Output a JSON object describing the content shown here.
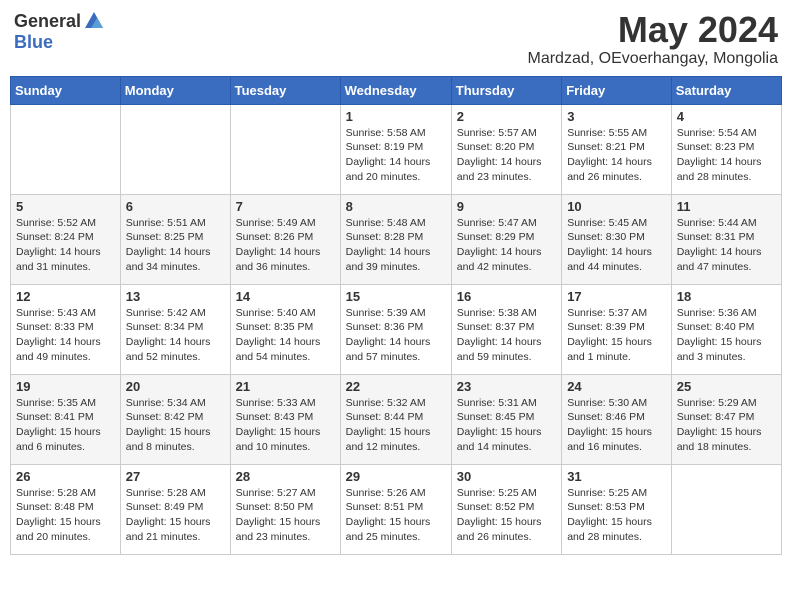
{
  "logo": {
    "general": "General",
    "blue": "Blue"
  },
  "title": "May 2024",
  "subtitle": "Mardzad, OEvoerhangay, Mongolia",
  "days_of_week": [
    "Sunday",
    "Monday",
    "Tuesday",
    "Wednesday",
    "Thursday",
    "Friday",
    "Saturday"
  ],
  "weeks": [
    [
      {
        "day": "",
        "info": ""
      },
      {
        "day": "",
        "info": ""
      },
      {
        "day": "",
        "info": ""
      },
      {
        "day": "1",
        "info": "Sunrise: 5:58 AM\nSunset: 8:19 PM\nDaylight: 14 hours\nand 20 minutes."
      },
      {
        "day": "2",
        "info": "Sunrise: 5:57 AM\nSunset: 8:20 PM\nDaylight: 14 hours\nand 23 minutes."
      },
      {
        "day": "3",
        "info": "Sunrise: 5:55 AM\nSunset: 8:21 PM\nDaylight: 14 hours\nand 26 minutes."
      },
      {
        "day": "4",
        "info": "Sunrise: 5:54 AM\nSunset: 8:23 PM\nDaylight: 14 hours\nand 28 minutes."
      }
    ],
    [
      {
        "day": "5",
        "info": "Sunrise: 5:52 AM\nSunset: 8:24 PM\nDaylight: 14 hours\nand 31 minutes."
      },
      {
        "day": "6",
        "info": "Sunrise: 5:51 AM\nSunset: 8:25 PM\nDaylight: 14 hours\nand 34 minutes."
      },
      {
        "day": "7",
        "info": "Sunrise: 5:49 AM\nSunset: 8:26 PM\nDaylight: 14 hours\nand 36 minutes."
      },
      {
        "day": "8",
        "info": "Sunrise: 5:48 AM\nSunset: 8:28 PM\nDaylight: 14 hours\nand 39 minutes."
      },
      {
        "day": "9",
        "info": "Sunrise: 5:47 AM\nSunset: 8:29 PM\nDaylight: 14 hours\nand 42 minutes."
      },
      {
        "day": "10",
        "info": "Sunrise: 5:45 AM\nSunset: 8:30 PM\nDaylight: 14 hours\nand 44 minutes."
      },
      {
        "day": "11",
        "info": "Sunrise: 5:44 AM\nSunset: 8:31 PM\nDaylight: 14 hours\nand 47 minutes."
      }
    ],
    [
      {
        "day": "12",
        "info": "Sunrise: 5:43 AM\nSunset: 8:33 PM\nDaylight: 14 hours\nand 49 minutes."
      },
      {
        "day": "13",
        "info": "Sunrise: 5:42 AM\nSunset: 8:34 PM\nDaylight: 14 hours\nand 52 minutes."
      },
      {
        "day": "14",
        "info": "Sunrise: 5:40 AM\nSunset: 8:35 PM\nDaylight: 14 hours\nand 54 minutes."
      },
      {
        "day": "15",
        "info": "Sunrise: 5:39 AM\nSunset: 8:36 PM\nDaylight: 14 hours\nand 57 minutes."
      },
      {
        "day": "16",
        "info": "Sunrise: 5:38 AM\nSunset: 8:37 PM\nDaylight: 14 hours\nand 59 minutes."
      },
      {
        "day": "17",
        "info": "Sunrise: 5:37 AM\nSunset: 8:39 PM\nDaylight: 15 hours\nand 1 minute."
      },
      {
        "day": "18",
        "info": "Sunrise: 5:36 AM\nSunset: 8:40 PM\nDaylight: 15 hours\nand 3 minutes."
      }
    ],
    [
      {
        "day": "19",
        "info": "Sunrise: 5:35 AM\nSunset: 8:41 PM\nDaylight: 15 hours\nand 6 minutes."
      },
      {
        "day": "20",
        "info": "Sunrise: 5:34 AM\nSunset: 8:42 PM\nDaylight: 15 hours\nand 8 minutes."
      },
      {
        "day": "21",
        "info": "Sunrise: 5:33 AM\nSunset: 8:43 PM\nDaylight: 15 hours\nand 10 minutes."
      },
      {
        "day": "22",
        "info": "Sunrise: 5:32 AM\nSunset: 8:44 PM\nDaylight: 15 hours\nand 12 minutes."
      },
      {
        "day": "23",
        "info": "Sunrise: 5:31 AM\nSunset: 8:45 PM\nDaylight: 15 hours\nand 14 minutes."
      },
      {
        "day": "24",
        "info": "Sunrise: 5:30 AM\nSunset: 8:46 PM\nDaylight: 15 hours\nand 16 minutes."
      },
      {
        "day": "25",
        "info": "Sunrise: 5:29 AM\nSunset: 8:47 PM\nDaylight: 15 hours\nand 18 minutes."
      }
    ],
    [
      {
        "day": "26",
        "info": "Sunrise: 5:28 AM\nSunset: 8:48 PM\nDaylight: 15 hours\nand 20 minutes."
      },
      {
        "day": "27",
        "info": "Sunrise: 5:28 AM\nSunset: 8:49 PM\nDaylight: 15 hours\nand 21 minutes."
      },
      {
        "day": "28",
        "info": "Sunrise: 5:27 AM\nSunset: 8:50 PM\nDaylight: 15 hours\nand 23 minutes."
      },
      {
        "day": "29",
        "info": "Sunrise: 5:26 AM\nSunset: 8:51 PM\nDaylight: 15 hours\nand 25 minutes."
      },
      {
        "day": "30",
        "info": "Sunrise: 5:25 AM\nSunset: 8:52 PM\nDaylight: 15 hours\nand 26 minutes."
      },
      {
        "day": "31",
        "info": "Sunrise: 5:25 AM\nSunset: 8:53 PM\nDaylight: 15 hours\nand 28 minutes."
      },
      {
        "day": "",
        "info": ""
      }
    ]
  ]
}
